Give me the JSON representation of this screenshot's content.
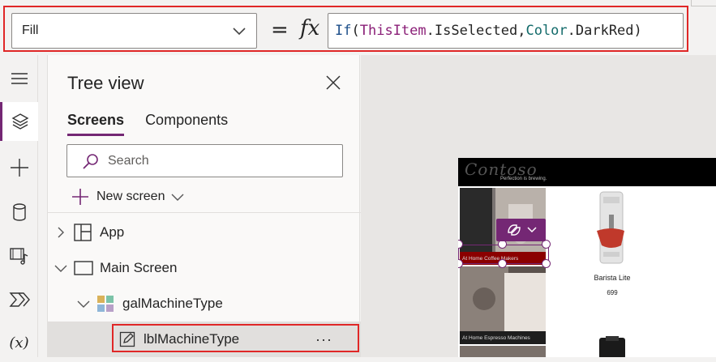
{
  "formula_bar": {
    "property": "Fill",
    "equals": "=",
    "fx": "fx",
    "formula_tokens": [
      {
        "text": "If",
        "kind": "fn"
      },
      {
        "text": "(",
        "kind": "p"
      },
      {
        "text": "ThisItem",
        "kind": "kw"
      },
      {
        "text": ".IsSelected,",
        "kind": "p"
      },
      {
        "text": "Color",
        "kind": "col"
      },
      {
        "text": ".DarkRed)",
        "kind": "p"
      }
    ]
  },
  "rail": {
    "items": [
      {
        "name": "hamburger-menu-icon"
      },
      {
        "name": "layers-icon",
        "active": true
      },
      {
        "name": "insert-plus-icon"
      },
      {
        "name": "data-icon"
      },
      {
        "name": "media-icon"
      },
      {
        "name": "power-automate-icon"
      },
      {
        "name": "variables-icon",
        "text": "(x)"
      }
    ]
  },
  "tree": {
    "title": "Tree view",
    "tabs": [
      "Screens",
      "Components"
    ],
    "active_tab": "Screens",
    "search_placeholder": "Search",
    "new_screen": "New screen",
    "nodes": [
      {
        "label": "App",
        "icon": "app-icon",
        "caret": "right"
      },
      {
        "label": "Main Screen",
        "icon": "screen-icon",
        "caret": "down"
      },
      {
        "label": "galMachineType",
        "icon": "gallery-icon",
        "caret": "down"
      },
      {
        "label": "lblMachineType",
        "icon": "label-edit-icon",
        "selected": true
      }
    ],
    "more": "···"
  },
  "canvas": {
    "logo": "Contoso",
    "tagline": "Perfection is brewing.",
    "tiles": [
      {
        "label": "At Home Coffee Makers"
      },
      {
        "label": "At Home Espresso Machines"
      }
    ],
    "product": {
      "name": "Barista Lite",
      "price": "699"
    }
  },
  "colors": {
    "accent": "#742774",
    "highlight_outline": "#e02727",
    "dark_red": "#8b0000"
  }
}
